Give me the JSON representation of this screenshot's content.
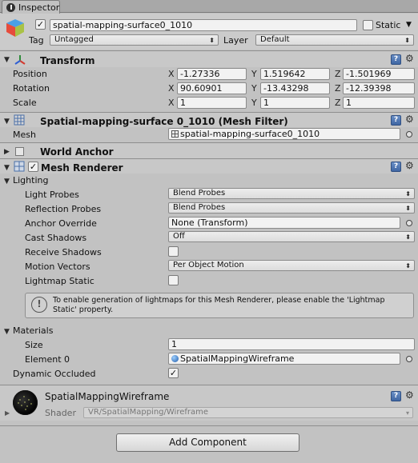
{
  "tab": {
    "title": "Inspector"
  },
  "object": {
    "active": true,
    "name": "spatial-mapping-surface0_1010",
    "static_label": "Static",
    "tag_label": "Tag",
    "tag_value": "Untagged",
    "layer_label": "Layer",
    "layer_value": "Default"
  },
  "transform": {
    "title": "Transform",
    "rows": [
      {
        "label": "Position",
        "x": "-1.27336",
        "y": "1.519642",
        "z": "-1.501969"
      },
      {
        "label": "Rotation",
        "x": "90.60901",
        "y": "-13.43298",
        "z": "-12.39398"
      },
      {
        "label": "Scale",
        "x": "1",
        "y": "1",
        "z": "1"
      }
    ],
    "axis_x": "X",
    "axis_y": "Y",
    "axis_z": "Z"
  },
  "mesh_filter": {
    "title": "Spatial-mapping-surface 0_1010 (Mesh Filter)",
    "mesh_label": "Mesh",
    "mesh_value": "spatial-mapping-surface0_1010"
  },
  "world_anchor": {
    "title": "World Anchor"
  },
  "mesh_renderer": {
    "title": "Mesh Renderer",
    "enabled": true,
    "lighting_label": "Lighting",
    "light_probes_label": "Light Probes",
    "light_probes_value": "Blend Probes",
    "reflection_probes_label": "Reflection Probes",
    "reflection_probes_value": "Blend Probes",
    "anchor_override_label": "Anchor Override",
    "anchor_override_value": "None (Transform)",
    "cast_shadows_label": "Cast Shadows",
    "cast_shadows_value": "Off",
    "receive_shadows_label": "Receive Shadows",
    "receive_shadows": false,
    "motion_vectors_label": "Motion Vectors",
    "motion_vectors_value": "Per Object Motion",
    "lightmap_static_label": "Lightmap Static",
    "lightmap_static": false,
    "help_text_line1": "To enable generation of lightmaps for this Mesh Renderer, please enable the 'Lightmap",
    "help_text_line2": "Static' property.",
    "materials_label": "Materials",
    "size_label": "Size",
    "size_value": "1",
    "element0_label": "Element 0",
    "element0_value": "SpatialMappingWireframe",
    "dynamic_occluded_label": "Dynamic Occluded",
    "dynamic_occluded": true
  },
  "material": {
    "name": "SpatialMappingWireframe",
    "shader_label": "Shader",
    "shader_value": "VR/SpatialMapping/Wireframe"
  },
  "add_component_label": "Add Component",
  "check_glyph": "✓",
  "icons": [
    "inspector-icon",
    "cube-icon",
    "transform-icon",
    "mesh-filter-icon",
    "mesh-renderer-icon",
    "help-icon",
    "gear-icon",
    "info-icon",
    "material-preview-icon"
  ]
}
